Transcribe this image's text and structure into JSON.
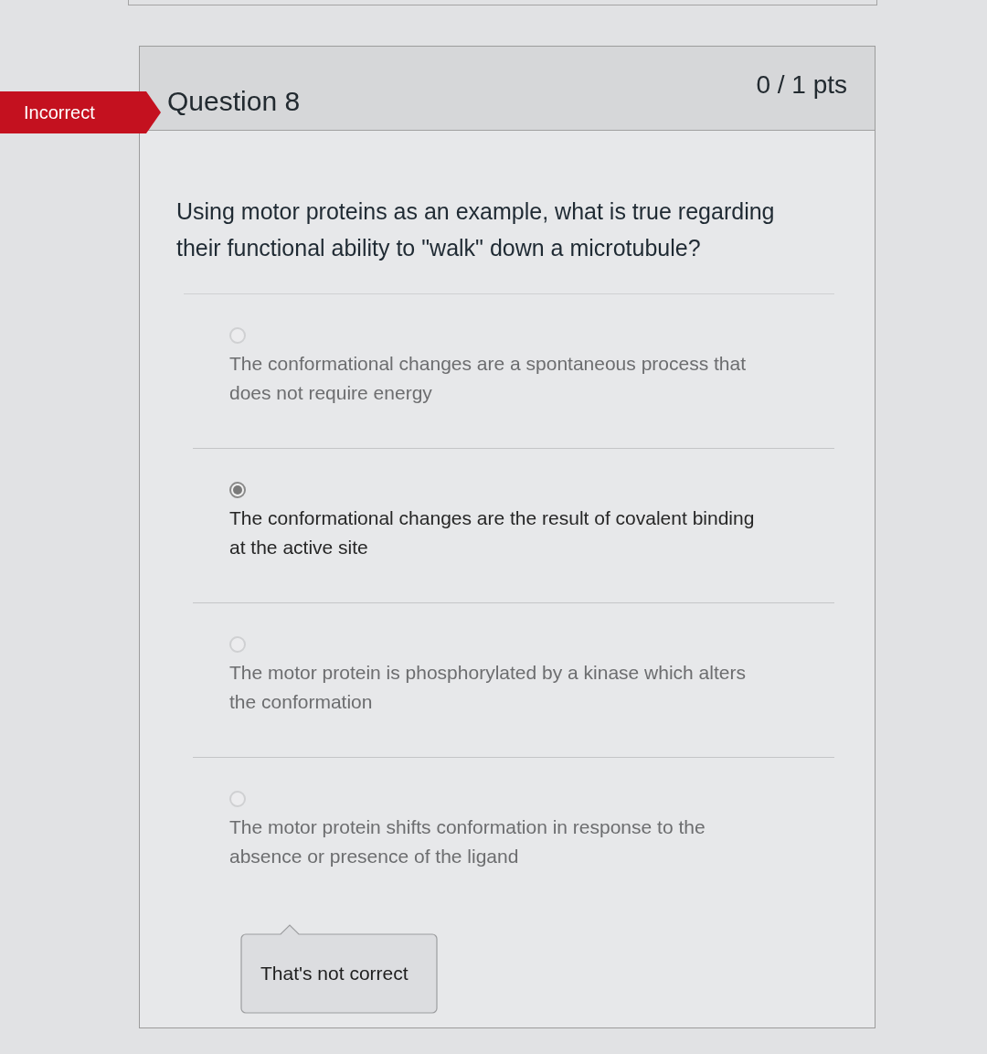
{
  "result_badge": {
    "label": "Incorrect",
    "kind": "incorrect"
  },
  "question": {
    "title": "Question 8",
    "points": "0 / 1 pts",
    "text": "Using motor proteins as an example, what is true regarding their functional ability to \"walk\" down a microtubule?"
  },
  "answers": [
    {
      "text": "The conformational changes are a spontaneous process that does not require energy",
      "selected": false
    },
    {
      "text": "The conformational changes are the result of covalent binding at the active site",
      "selected": true
    },
    {
      "text": "The motor protein is phosphorylated by a kinase which alters the conformation",
      "selected": false
    },
    {
      "text": "The motor protein shifts conformation in response to the absence or presence of the ligand",
      "selected": false
    }
  ],
  "feedback": {
    "text": "That's not correct"
  }
}
